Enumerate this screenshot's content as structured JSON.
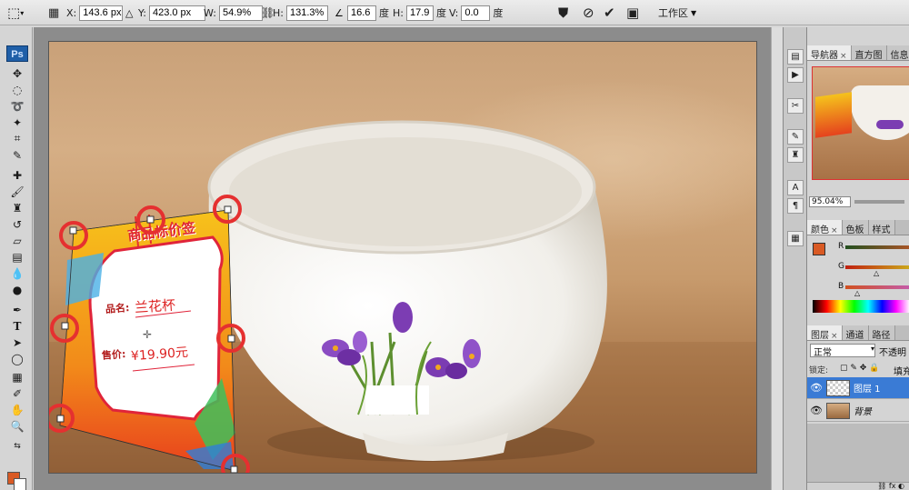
{
  "options_bar": {
    "x_label": "X:",
    "x_value": "143.6 px",
    "y_label": "Y:",
    "y_value": "423.0 px",
    "w_label": "W:",
    "w_value": "54.9%",
    "h_label": "H:",
    "h_value": "131.3%",
    "angle_value": "16.6",
    "angle_unit": "度",
    "hskew_label": "H:",
    "hskew_value": "17.9",
    "hskew_unit": "度",
    "vskew_label": "V:",
    "vskew_value": "0.0",
    "vskew_unit": "度",
    "workspace_label": "工作区"
  },
  "toolbox": {
    "logo": "Ps"
  },
  "canvas": {
    "card_title": "商品标价签",
    "name_label": "品名:",
    "name_value": "兰花杯",
    "price_label": "售价:",
    "price_value": "¥19.90元"
  },
  "navigator_panel": {
    "tabs": [
      "导航器",
      "直方图",
      "信息"
    ],
    "zoom": "95.04%"
  },
  "color_panel": {
    "tabs": [
      "颜色",
      "色板",
      "样式"
    ],
    "channels": [
      "R",
      "G",
      "B"
    ],
    "channel_levels": [
      0.95,
      0.35,
      0.14
    ],
    "fg_color": "#d95a24"
  },
  "layers_panel": {
    "tabs": [
      "图层",
      "通道",
      "路径"
    ],
    "blend_mode": "正常",
    "opacity_label": "不透明",
    "lock_label": "锁定:",
    "fill_label": "填充",
    "layers": [
      {
        "name": "图层 1",
        "selected": true
      },
      {
        "name": "背景",
        "selected": false
      }
    ]
  },
  "colors": {
    "accent_selection": "#3a7bd5",
    "handle_circles": "#e53030"
  }
}
